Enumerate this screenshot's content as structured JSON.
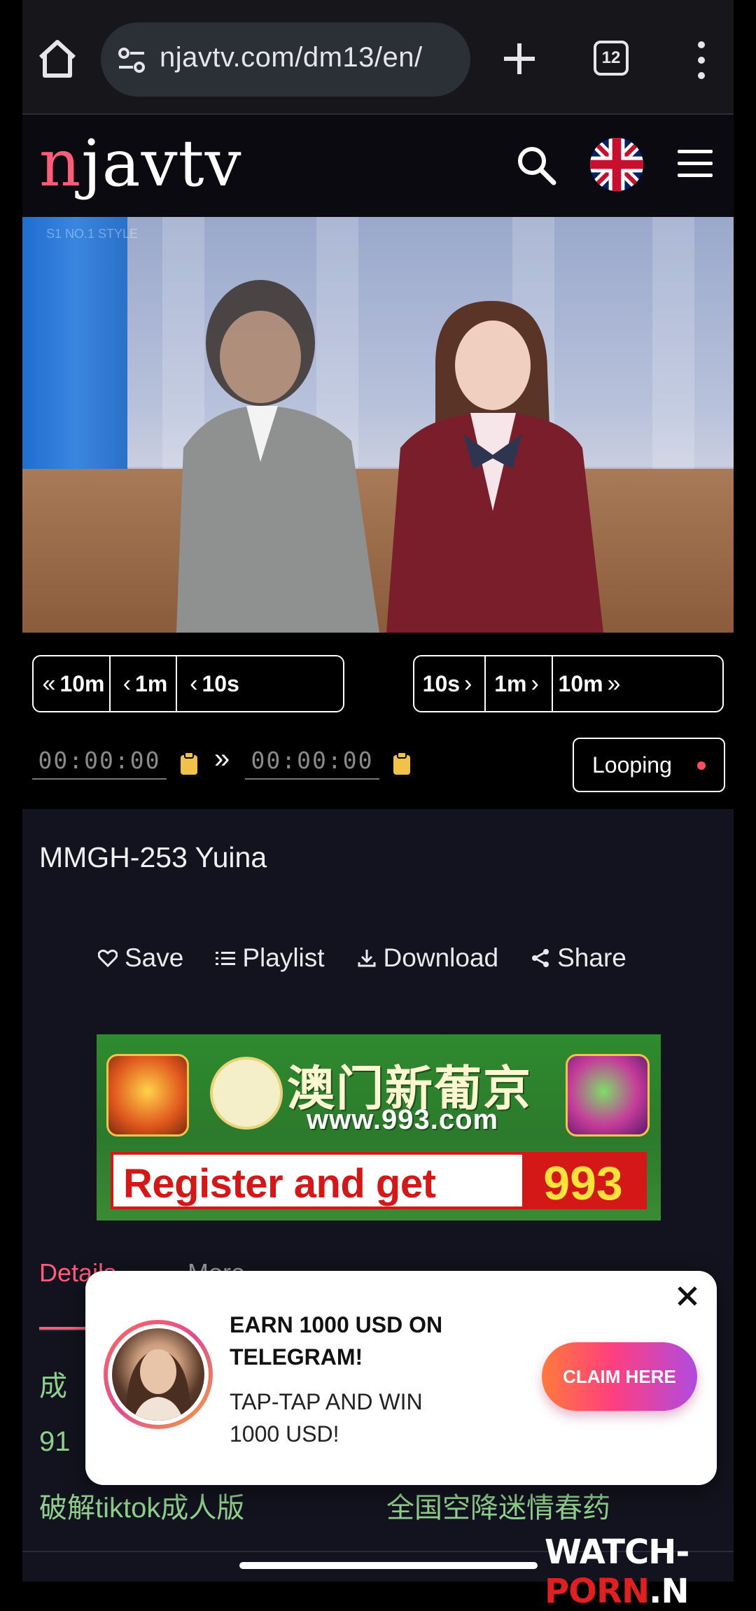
{
  "browser": {
    "url": "njavtv.com/dm13/en/",
    "tab_count": "12"
  },
  "site": {
    "logo_n": "n",
    "logo_rest": "javtv"
  },
  "video": {
    "watermark": "S1 NO.1 STYLE"
  },
  "controls": {
    "seek_back": [
      "10m",
      "1m",
      "10s"
    ],
    "seek_forward": [
      "10s",
      "1m",
      "10m"
    ],
    "start_time": "00:00:00",
    "end_time": "00:00:00",
    "raquo": "»",
    "looping_label": "Looping"
  },
  "title": "MMGH-253 Yuina",
  "actions": {
    "save": "Save",
    "playlist": "Playlist",
    "download": "Download",
    "share": "Share"
  },
  "ad": {
    "cn_title": "澳门新葡京",
    "url": "www.993.com",
    "register": "Register and get",
    "amount": "993"
  },
  "tabs": {
    "active": "Details",
    "second": "More"
  },
  "links": [
    "成",
    "91",
    "破解tiktok成人版",
    "全国空降迷情春药"
  ],
  "popup": {
    "title": "EARN 1000 USD ON TELEGRAM!",
    "subtitle": "TAP-TAP AND WIN 1000 USD!",
    "cta": "CLAIM HERE"
  },
  "watermark": {
    "part1": "WATCH-",
    "part2": "PORN",
    "part3": ".N"
  },
  "colors": {
    "accent": "#ff5c7a",
    "link_green": "#8fcf8c",
    "background": "#13131f"
  }
}
